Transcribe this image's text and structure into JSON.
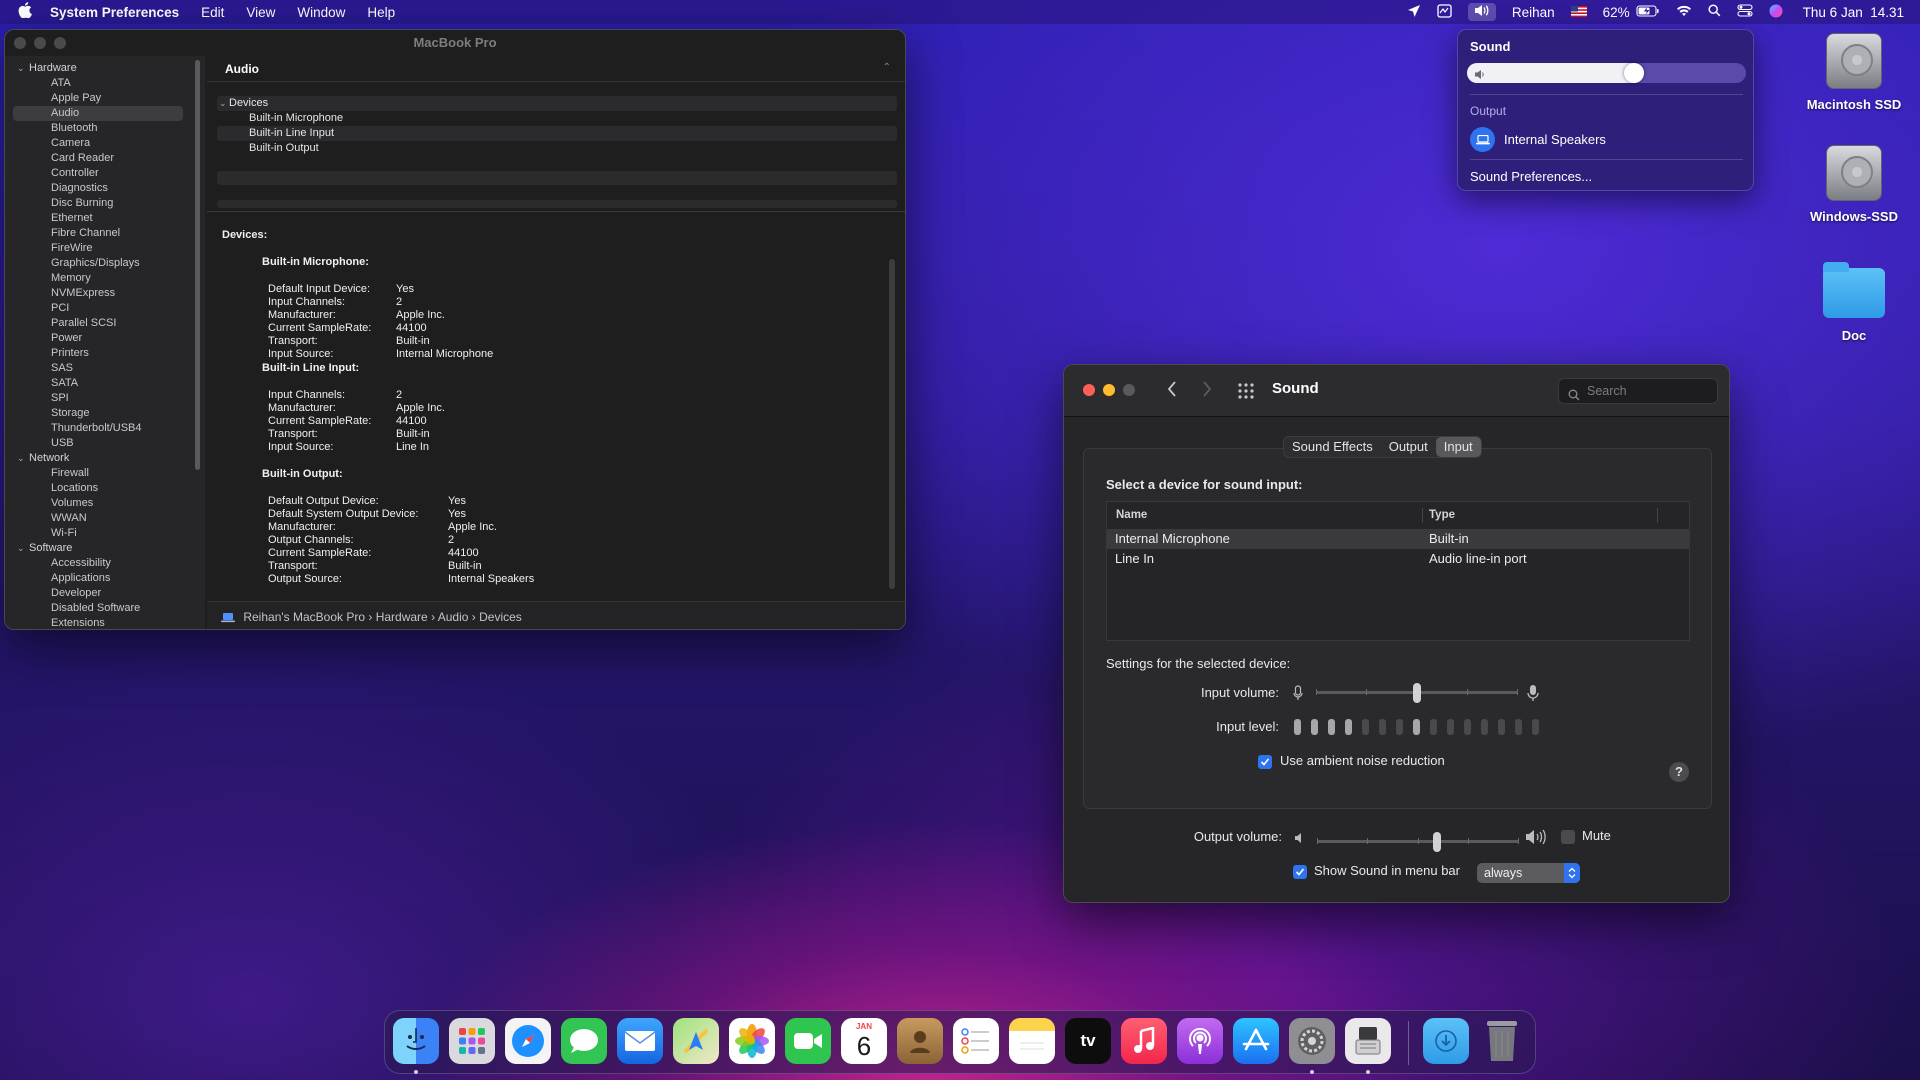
{
  "menubar": {
    "app": "System Preferences",
    "menus": [
      "Edit",
      "View",
      "Window",
      "Help"
    ],
    "user": "Reihan",
    "battery": "62%",
    "datetime": "Thu 6 Jan  14.31"
  },
  "sysinfo": {
    "window_title": "MacBook Pro",
    "sidebar": {
      "hardware_label": "Hardware",
      "hardware_items": [
        "ATA",
        "Apple Pay",
        "Audio",
        "Bluetooth",
        "Camera",
        "Card Reader",
        "Controller",
        "Diagnostics",
        "Disc Burning",
        "Ethernet",
        "Fibre Channel",
        "FireWire",
        "Graphics/Displays",
        "Memory",
        "NVMExpress",
        "PCI",
        "Parallel SCSI",
        "Power",
        "Printers",
        "SAS",
        "SATA",
        "SPI",
        "Storage",
        "Thunderbolt/USB4",
        "USB"
      ],
      "network_label": "Network",
      "network_items": [
        "Firewall",
        "Locations",
        "Volumes",
        "WWAN",
        "Wi-Fi"
      ],
      "software_label": "Software",
      "software_items": [
        "Accessibility",
        "Applications",
        "Developer",
        "Disabled Software",
        "Extensions"
      ],
      "selected": "Audio"
    },
    "section_header": "Audio",
    "tree_group": "Devices",
    "tree_items": [
      "Built-in Microphone",
      "Built-in Line Input",
      "Built-in Output"
    ],
    "details": {
      "heading": "Devices:",
      "mic": {
        "title": "Built-in Microphone:",
        "rows": [
          [
            "Default Input Device:",
            "Yes"
          ],
          [
            "Input Channels:",
            "2"
          ],
          [
            "Manufacturer:",
            "Apple Inc."
          ],
          [
            "Current SampleRate:",
            "44100"
          ],
          [
            "Transport:",
            "Built-in"
          ],
          [
            "Input Source:",
            "Internal Microphone"
          ]
        ]
      },
      "line": {
        "title": "Built-in Line Input:",
        "rows": [
          [
            "Input Channels:",
            "2"
          ],
          [
            "Manufacturer:",
            "Apple Inc."
          ],
          [
            "Current SampleRate:",
            "44100"
          ],
          [
            "Transport:",
            "Built-in"
          ],
          [
            "Input Source:",
            "Line In"
          ]
        ]
      },
      "out": {
        "title": "Built-in Output:",
        "rows": [
          [
            "Default Output Device:",
            "Yes"
          ],
          [
            "Default System Output Device:",
            "Yes"
          ],
          [
            "Manufacturer:",
            "Apple Inc."
          ],
          [
            "Output Channels:",
            "2"
          ],
          [
            "Current SampleRate:",
            "44100"
          ],
          [
            "Transport:",
            "Built-in"
          ],
          [
            "Output Source:",
            "Internal Speakers"
          ]
        ]
      }
    },
    "path": [
      "Reihan's MacBook Pro",
      "Hardware",
      "Audio",
      "Devices"
    ]
  },
  "sound_popover": {
    "title": "Sound",
    "volume": 0.6,
    "output_label": "Output",
    "device": "Internal Speakers",
    "prefs_link": "Sound Preferences..."
  },
  "desktop": {
    "icons": [
      "Macintosh SSD",
      "Windows-SSD",
      "Doc"
    ]
  },
  "sound_prefs": {
    "title": "Sound",
    "search_placeholder": "Search",
    "tabs": [
      "Sound Effects",
      "Output",
      "Input"
    ],
    "active_tab": "Input",
    "select_label": "Select a device for sound input:",
    "columns": [
      "Name",
      "Type"
    ],
    "rows": [
      [
        "Internal Microphone",
        "Built-in"
      ],
      [
        "Line In",
        "Audio line-in port"
      ]
    ],
    "settings_label": "Settings for the selected device:",
    "input_volume_label": "Input volume:",
    "input_volume": 0.5,
    "input_level_label": "Input level:",
    "input_level_bars": 15,
    "input_level_active": [
      1,
      2,
      3,
      4,
      8
    ],
    "ambient_label": "Use ambient noise reduction",
    "ambient_checked": true,
    "output_volume_label": "Output volume:",
    "output_volume": 0.6,
    "mute_label": "Mute",
    "show_menu_label": "Show Sound in menu bar",
    "show_menu_value": "always",
    "help": "?"
  },
  "dock": {
    "calendar_month": "JAN",
    "calendar_day": "6",
    "tv_label": "tv",
    "apps": [
      "finder",
      "launchpad",
      "safari",
      "messages",
      "mail",
      "maps",
      "photos",
      "facetime",
      "calendar",
      "contacts",
      "reminders",
      "notes",
      "tv",
      "music",
      "podcasts",
      "app-store",
      "system-preferences",
      "system-information",
      "downloads",
      "trash"
    ]
  },
  "colors": {
    "accent": "#2f73f0",
    "red": "#ff5f57",
    "yellow": "#febc2e"
  }
}
